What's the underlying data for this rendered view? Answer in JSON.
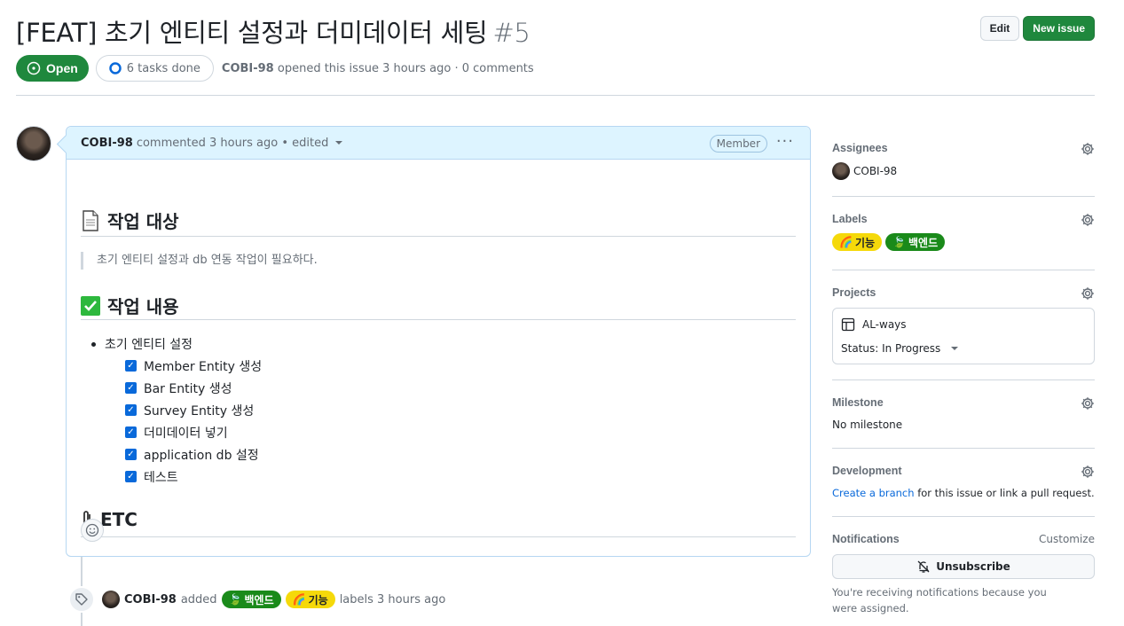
{
  "issue": {
    "title": "[FEAT] 초기 엔티티 설정과 더미데이터 세팅",
    "number": "#5",
    "edit_label": "Edit",
    "new_issue_label": "New issue",
    "state": "Open",
    "tasks": "6 tasks done",
    "author": "COBI-98",
    "opened_text": "opened this issue 3 hours ago · 0 comments"
  },
  "comment": {
    "author": "COBI-98",
    "meta": "commented 3 hours ago • edited",
    "badge": "Member",
    "sections": {
      "target_heading": "작업 대상",
      "target_quote": "초기 엔티티 설정과 db 연동 작업이 필요하다.",
      "content_heading": "작업 내용",
      "bullet": "초기 엔티티 설정",
      "tasks": [
        "Member Entity 생성",
        "Bar Entity 생성",
        "Survey Entity 생성",
        "더미데이터 넣기",
        "application db 설정",
        "테스트"
      ],
      "etc_heading": "ETC"
    }
  },
  "timeline": {
    "author": "COBI-98",
    "added": "added",
    "labels_suffix": "labels 3 hours ago",
    "label1": "백엔드",
    "label2": "기능"
  },
  "sidebar": {
    "assignees_title": "Assignees",
    "assignee": "COBI-98",
    "labels_title": "Labels",
    "label_feature": "기능",
    "label_backend": "백엔드",
    "projects_title": "Projects",
    "project_name": "AL-ways",
    "project_status": "Status: In Progress",
    "milestone_title": "Milestone",
    "milestone_value": "No milestone",
    "development_title": "Development",
    "dev_link": "Create a branch",
    "dev_text": " for this issue or link a pull request.",
    "notifications_title": "Notifications",
    "customize": "Customize",
    "unsubscribe": "Unsubscribe",
    "notif_reason": "You're receiving notifications because you were assigned."
  },
  "colors": {
    "accent": "#0969da",
    "open_green": "#1f883d",
    "label_yellow": "#f5d90a",
    "label_green": "#1a8a1a"
  }
}
